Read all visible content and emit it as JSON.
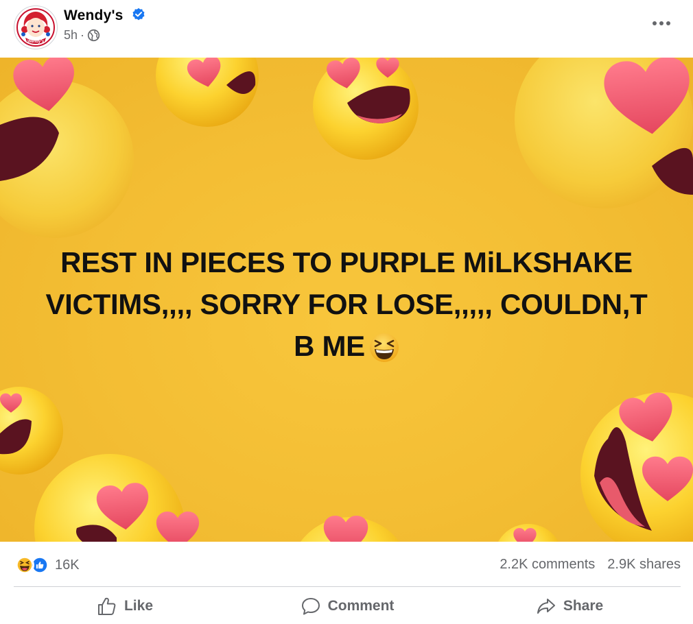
{
  "post": {
    "author": "Wendy's",
    "time": "5h",
    "separator": "·",
    "avatar_alt_text": "Wendy's",
    "verified": true,
    "audience_icon": "globe-icon",
    "more_icon": "more-horizontal-icon"
  },
  "image": {
    "text_lines": [
      "REST IN PIECES TO PURPLE MiLKSHAKE",
      "VICTIMS,,,, SORRY FOR LOSE,,,,, COULDN,T",
      "B ME"
    ],
    "trailing_emoji": "grinning-squinting-face",
    "background_color": "#F3BD33",
    "decoration": "heart-eyes-emoji"
  },
  "stats": {
    "reaction_icons": [
      "haha-reaction-icon",
      "like-reaction-icon"
    ],
    "reaction_count": "16K",
    "comments": "2.2K comments",
    "shares": "2.9K shares"
  },
  "actions": [
    {
      "label": "Like",
      "icon": "thumbs-up-icon"
    },
    {
      "label": "Comment",
      "icon": "comment-icon"
    },
    {
      "label": "Share",
      "icon": "share-arrow-icon"
    }
  ],
  "colors": {
    "verified": "#1877F2",
    "secondary_text": "#65676B",
    "like_blue": "#1877F2",
    "haha_yellow": "#F7B928",
    "heart_pink": "#F0506E"
  }
}
